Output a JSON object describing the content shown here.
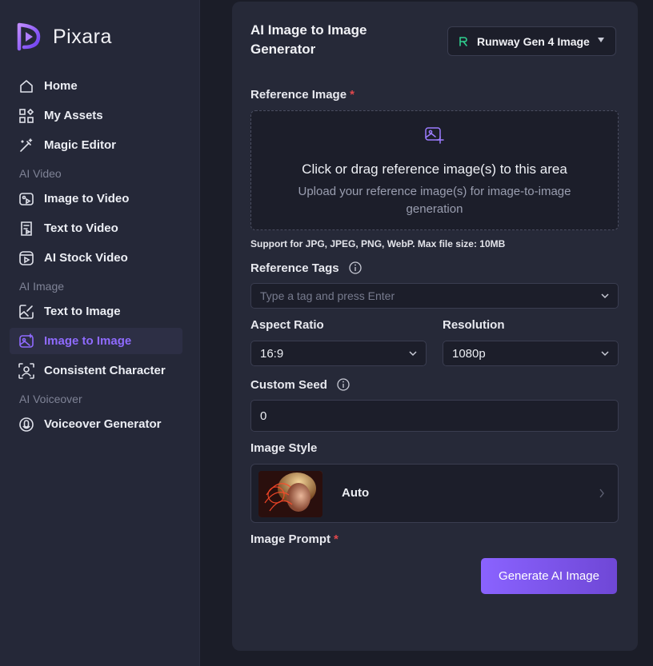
{
  "app": {
    "name": "Pixara"
  },
  "sidebar": {
    "items": [
      {
        "label": "Home",
        "icon": "home-icon"
      },
      {
        "label": "My Assets",
        "icon": "assets-grid-icon"
      },
      {
        "label": "Magic Editor",
        "icon": "magic-wand-icon"
      },
      {
        "label": "Image to Video",
        "icon": "image-video-icon"
      },
      {
        "label": "Text to Video",
        "icon": "text-video-icon"
      },
      {
        "label": "AI Stock Video",
        "icon": "stock-video-icon"
      },
      {
        "label": "Text to Image",
        "icon": "text-image-icon"
      },
      {
        "label": "Image to Image",
        "icon": "image-image-icon",
        "active": true
      },
      {
        "label": "Consistent Character",
        "icon": "character-icon"
      },
      {
        "label": "Voiceover Generator",
        "icon": "voiceover-icon"
      }
    ],
    "sections": {
      "video": "AI Video",
      "image": "AI Image",
      "voice": "AI Voiceover"
    }
  },
  "main": {
    "title": "AI Image to Image Generator",
    "model": {
      "selected": "Runway Gen 4 Image",
      "icon": "runway-icon"
    },
    "reference_image": {
      "label": "Reference Image",
      "required_mark": "*",
      "drop_title": "Click or drag reference image(s) to this area",
      "drop_subtitle": "Upload your reference image(s) for image-to-image generation",
      "support_note": "Support for JPG, JPEG, PNG, WebP. Max file size: 10MB"
    },
    "reference_tags": {
      "label": "Reference Tags",
      "placeholder": "Type a tag and press Enter"
    },
    "aspect_ratio": {
      "label": "Aspect Ratio",
      "value": "16:9"
    },
    "resolution": {
      "label": "Resolution",
      "value": "1080p"
    },
    "custom_seed": {
      "label": "Custom Seed",
      "value": "0"
    },
    "image_style": {
      "label": "Image Style",
      "value": "Auto"
    },
    "image_prompt": {
      "label": "Image Prompt",
      "required_mark": "*"
    },
    "generate_button": "Generate AI Image"
  },
  "colors": {
    "accent": "#8f6bff",
    "required": "#e0474c",
    "background": "#1b1d28",
    "panel": "#262938"
  }
}
